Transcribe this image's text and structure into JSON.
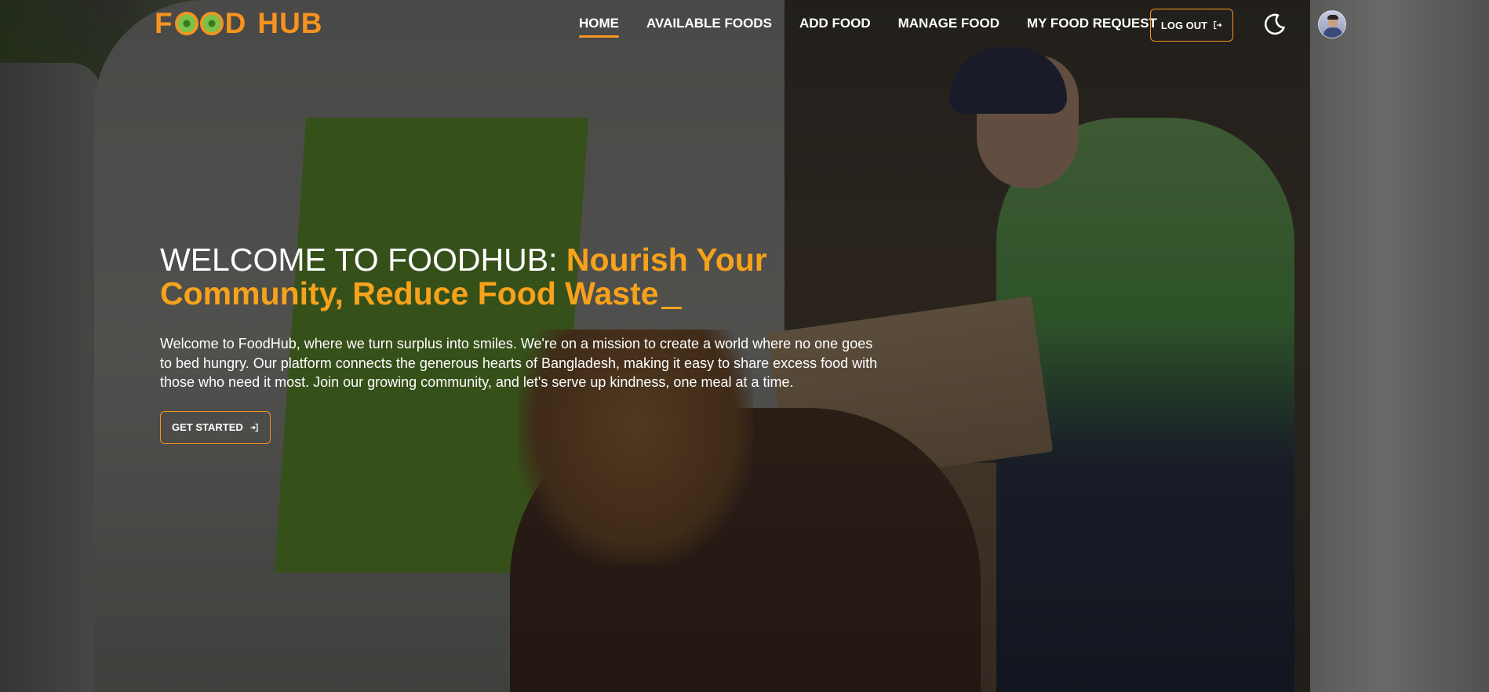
{
  "brand": {
    "logo_text_left": "F",
    "logo_text_mid": "D",
    "logo_text_right": "HUB",
    "accent_color": "#f7931e"
  },
  "nav": {
    "items": [
      {
        "label": "HOME",
        "active": true
      },
      {
        "label": "AVAILABLE FOODS",
        "active": false
      },
      {
        "label": "ADD FOOD",
        "active": false
      },
      {
        "label": "MANAGE FOOD",
        "active": false
      },
      {
        "label": "MY FOOD REQUEST",
        "active": false
      }
    ],
    "logout_label": "LOG OUT",
    "logout_icon": "logout-icon",
    "theme_icon": "moon-icon",
    "avatar_icon": "user-avatar"
  },
  "hero": {
    "title_prefix": "WELCOME TO FOODHUB: ",
    "title_accent": "Nourish Your Community, Reduce Food Waste",
    "description": "Welcome to FoodHub, where we turn surplus into smiles. We're on a mission to create a world where no one goes to bed hungry. Our platform connects the generous hearts of Bangladesh, making it easy to share excess food with those who need it most. Join our growing community, and let's serve up kindness, one meal at a time.",
    "cta_label": "GET STARTED",
    "cta_icon": "login-arrow-icon",
    "background": "food-donation-van-photo"
  }
}
